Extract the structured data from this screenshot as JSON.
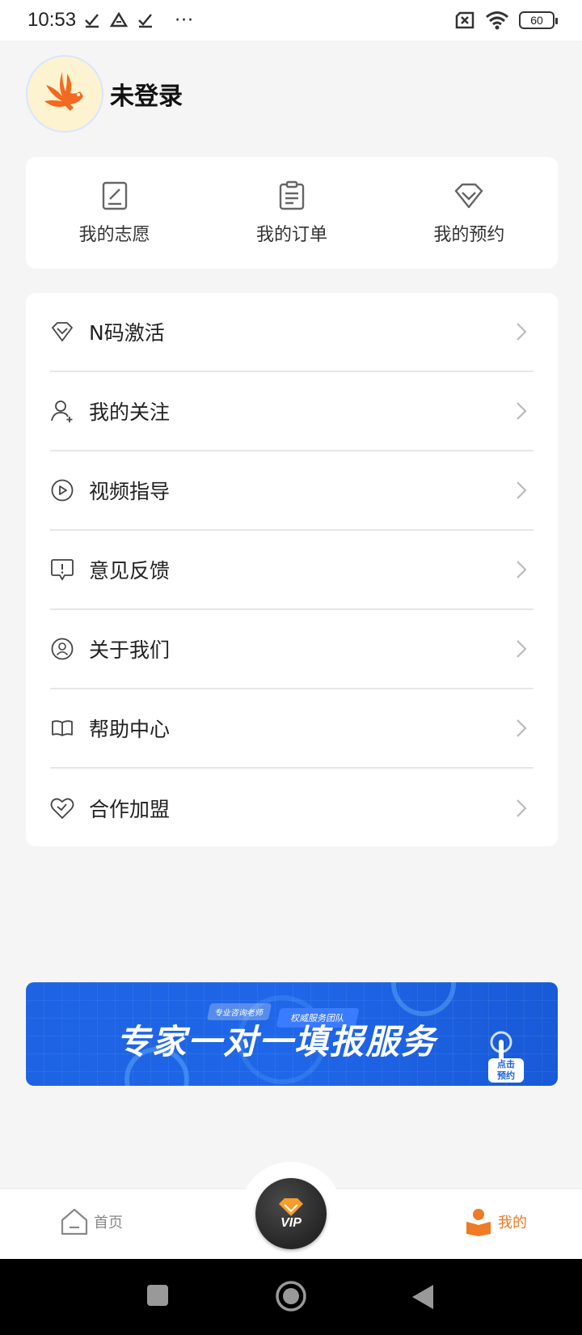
{
  "status_bar": {
    "time": "10:53",
    "more": "···",
    "battery": "60"
  },
  "profile": {
    "name": "未登录"
  },
  "quick_actions": [
    {
      "label": "我的志愿",
      "icon": "document-edit-icon"
    },
    {
      "label": "我的订单",
      "icon": "clipboard-icon"
    },
    {
      "label": "我的预约",
      "icon": "diamond-icon"
    }
  ],
  "menu": [
    {
      "label": "N码激活",
      "icon": "diamond-icon"
    },
    {
      "label": "我的关注",
      "icon": "user-add-icon"
    },
    {
      "label": "视频指导",
      "icon": "play-circle-icon"
    },
    {
      "label": "意见反馈",
      "icon": "feedback-icon"
    },
    {
      "label": "关于我们",
      "icon": "about-icon"
    },
    {
      "label": "帮助中心",
      "icon": "book-icon"
    },
    {
      "label": "合作加盟",
      "icon": "partner-icon"
    }
  ],
  "banner": {
    "title": "专家一对一填报服务",
    "tag_1": "专业咨询老师",
    "tag_2": "权威服务团队",
    "cta_line_1": "点击",
    "cta_line_2": "预约"
  },
  "bottom_nav": {
    "home_label": "首页",
    "vip_label": "VIP",
    "mine_label": "我的",
    "active_color": "#f07a25",
    "inactive_color": "#888888"
  }
}
